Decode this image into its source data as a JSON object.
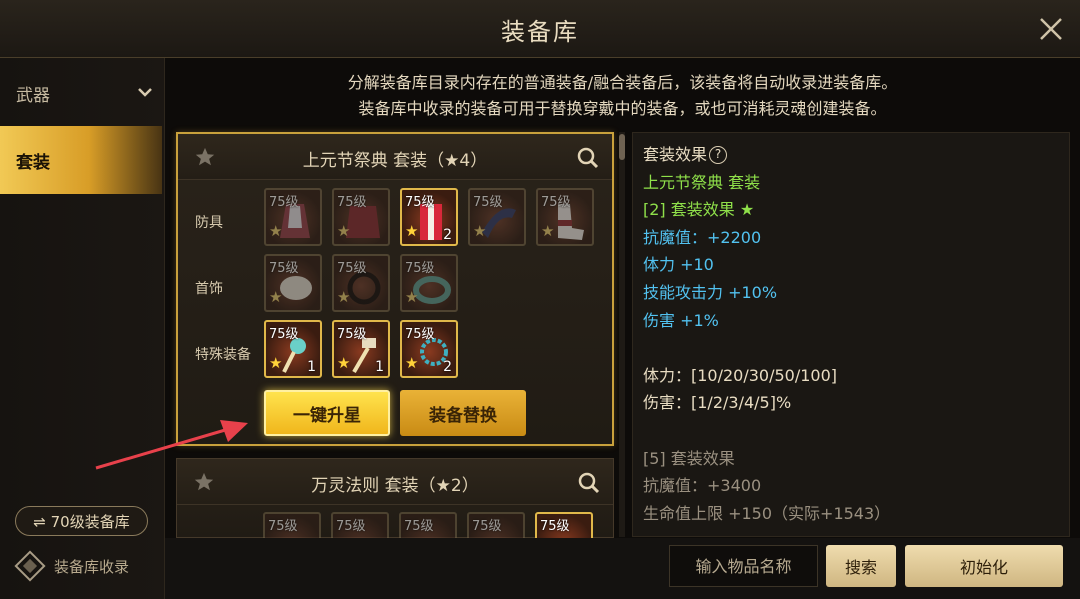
{
  "window": {
    "title": "装备库"
  },
  "sidebar": {
    "items": [
      {
        "label": "武器"
      },
      {
        "label": "套装"
      }
    ],
    "level_button": "⇌ 70级装备库",
    "collect_label": "装备库收录"
  },
  "description": {
    "line1": "分解装备库目录内存在的普通装备/融合装备后，该装备将自动收录进装备库。",
    "line2": "装备库中收录的装备可用于替换穿戴中的装备，或也可消耗灵魂创建装备。"
  },
  "suits": [
    {
      "title": "上元节祭典  套装（★4）",
      "rows": [
        {
          "label": "防具",
          "slots": [
            {
              "level": "75级",
              "count": "",
              "active": false
            },
            {
              "level": "75级",
              "count": "",
              "active": false
            },
            {
              "level": "75级",
              "count": "2",
              "active": true
            },
            {
              "level": "75级",
              "count": "",
              "active": false
            },
            {
              "level": "75级",
              "count": "",
              "active": false
            }
          ]
        },
        {
          "label": "首饰",
          "slots": [
            {
              "level": "75级",
              "count": "",
              "active": false
            },
            {
              "level": "75级",
              "count": "",
              "active": false
            },
            {
              "level": "75级",
              "count": "",
              "active": false
            }
          ]
        },
        {
          "label": "特殊装备",
          "slots": [
            {
              "level": "75级",
              "count": "1",
              "active": true
            },
            {
              "level": "75级",
              "count": "1",
              "active": true
            },
            {
              "level": "75级",
              "count": "2",
              "active": true
            }
          ]
        }
      ],
      "upgrade_button": "一键升星",
      "replace_button": "装备替换"
    },
    {
      "title": "万灵法则  套装（★2）",
      "slot_levels": [
        "75级",
        "75级",
        "75级",
        "75级",
        "75级"
      ]
    }
  ],
  "effect_panel": {
    "header": "套装效果",
    "lines": [
      {
        "text": "上元节祭典  套装",
        "color": "green"
      },
      {
        "text": "[2] 套装效果 ★",
        "color": "green"
      },
      {
        "text": "抗魔值：+2200",
        "color": "blue"
      },
      {
        "text": "体力 +10",
        "color": "blue"
      },
      {
        "text": "技能攻击力 +10%",
        "color": "blue"
      },
      {
        "text": "伤害 +1%",
        "color": "blue"
      },
      {
        "text": "",
        "color": "white"
      },
      {
        "text": "体力：[10/20/30/50/100]",
        "color": "white"
      },
      {
        "text": "伤害：[1/2/3/4/5]%",
        "color": "white"
      },
      {
        "text": "",
        "color": "white"
      },
      {
        "text": "[5] 套装效果",
        "color": "grey"
      },
      {
        "text": "抗魔值：+3400",
        "color": "grey"
      },
      {
        "text": "生命值上限 +150（实际+1543）",
        "color": "grey"
      }
    ]
  },
  "bottom": {
    "search_placeholder": "输入物品名称",
    "search_button": "搜索",
    "reset_button": "初始化"
  },
  "colors": {
    "accent": "#f0b61c",
    "green": "#8fe04a",
    "blue": "#52c2f0"
  }
}
